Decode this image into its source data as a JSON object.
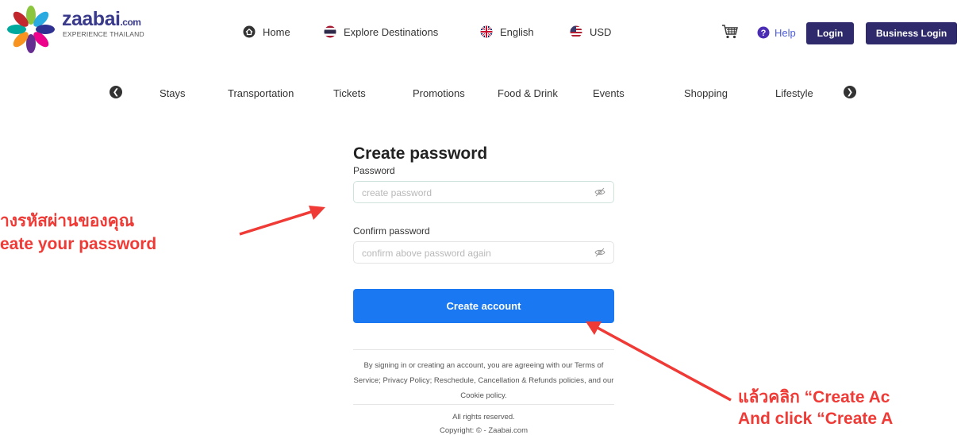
{
  "brand": {
    "name": "zaabai",
    "tld": ".com",
    "tagline": "EXPERIENCE THAILAND"
  },
  "header": {
    "home": "Home",
    "explore": "Explore Destinations",
    "language": "English",
    "currency": "USD",
    "help": "Help",
    "login": "Login",
    "business_login": "Business Login"
  },
  "categories": [
    "Stays",
    "Transportation",
    "Tickets",
    "Promotions",
    "Food & Drink",
    "Events",
    "Shopping",
    "Lifestyle"
  ],
  "form": {
    "title": "Create password",
    "password_label": "Password",
    "password_placeholder": "create password",
    "confirm_label": "Confirm password",
    "confirm_placeholder": "confirm above password again",
    "submit_label": "Create account"
  },
  "legal": {
    "terms": "By signing in or creating an account, you are agreeing with our Terms of Service; Privacy Policy; Reschedule, Cancellation & Refunds policies, and our Cookie policy.",
    "rights": "All rights reserved.",
    "copyright": "Copyright: © - Zaabai.com"
  },
  "annotations": {
    "left_th": "างรหัสผ่านของคุณ",
    "left_en": "eate your password",
    "right_th": "แล้วคลิก “Create Ac",
    "right_en": "And click “Create A"
  },
  "colors": {
    "navy": "#2e2a6b",
    "primary": "#1a78f2",
    "annotation": "#ef3a36"
  }
}
